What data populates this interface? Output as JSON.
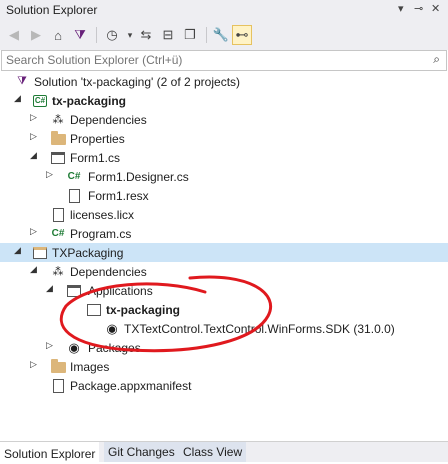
{
  "window": {
    "title": "Solution Explorer",
    "controls": [
      "▾",
      "⊸",
      "✕"
    ]
  },
  "toolbar": {
    "icons": [
      "back-icon",
      "forward-icon",
      "home-icon",
      "vs-switch-icon",
      "history-icon",
      "sync-icon",
      "collapse-icon",
      "show-all-files-icon",
      "properties-icon",
      "preview-icon"
    ]
  },
  "search": {
    "placeholder": "Search Solution Explorer (Ctrl+ü)"
  },
  "tree": {
    "solution": "Solution 'tx-packaging' (2 of 2 projects)",
    "project1": "tx-packaging",
    "dependencies": "Dependencies",
    "properties": "Properties",
    "form1": "Form1.cs",
    "form1_designer": "Form1.Designer.cs",
    "form1_resx": "Form1.resx",
    "licenses": "licenses.licx",
    "program": "Program.cs",
    "project2": "TXPackaging",
    "dependencies2": "Dependencies",
    "applications": "Applications",
    "app_txpackaging": "tx-packaging",
    "sdk": "TXTextControl.TextControl.WinForms.SDK (31.0.0)",
    "packages": "Packages",
    "images": "Images",
    "manifest": "Package.appxmanifest"
  },
  "tabs": [
    "Solution Explorer",
    "Git Changes",
    "Class View"
  ],
  "colors": {
    "selection": "#cce4f7",
    "annotation": "#e0191e",
    "csharp_green": "#1e7b35",
    "folder": "#dcb67a"
  }
}
